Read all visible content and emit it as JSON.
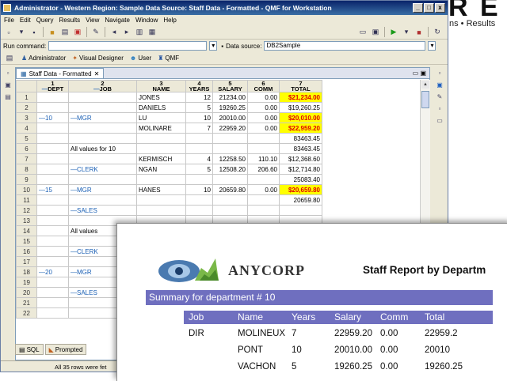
{
  "background_overlay": {
    "big_letters": "R E",
    "text": "ns • Results"
  },
  "window": {
    "title": "Administrator - Western Region: Sample Data Source: Staff Data - Formatted - QMF for Workstation",
    "controls": [
      "_",
      "□",
      "x"
    ]
  },
  "menubar": [
    "File",
    "Edit",
    "Query",
    "Results",
    "View",
    "Navigate",
    "Window",
    "Help"
  ],
  "runbar": {
    "run_label": "Run command:",
    "run_value": "",
    "source_label": "Data source:",
    "source_value": "DB2Sample"
  },
  "perspectives": [
    {
      "icon": "admin-icon",
      "label": "Administrator"
    },
    {
      "icon": "designer-icon",
      "label": "Visual Designer"
    },
    {
      "icon": "user-icon",
      "label": "User"
    },
    {
      "icon": "qmf-icon",
      "label": "QMF"
    }
  ],
  "editor_tab": {
    "label": "Staff Data - Formatted"
  },
  "grid": {
    "col_numbers": [
      "1",
      "2",
      "3",
      "4",
      "5",
      "6",
      "7"
    ],
    "col_headers": [
      "DEPT",
      "JOB",
      "NAME",
      "YEARS",
      "SALARY",
      "COMM",
      "TOTAL"
    ],
    "col_header_prefixes": [
      "—",
      "—",
      "",
      "",
      "",
      "",
      ""
    ],
    "rows": [
      {
        "n": "1",
        "dept": "",
        "job": "",
        "name": "JONES",
        "years": "12",
        "salary": "21234.00",
        "comm": "0.00",
        "total": "$21,234.00",
        "hl": true
      },
      {
        "n": "2",
        "dept": "",
        "job": "",
        "name": "DANIELS",
        "years": "5",
        "salary": "19260.25",
        "comm": "0.00",
        "total": "$19,260.25",
        "hl": false
      },
      {
        "n": "3",
        "dept": "—10",
        "job": "—MGR",
        "name": "LU",
        "years": "10",
        "salary": "20010.00",
        "comm": "0.00",
        "total": "$20,010.00",
        "hl": true
      },
      {
        "n": "4",
        "dept": "",
        "job": "",
        "name": "MOLINARE",
        "years": "7",
        "salary": "22959.20",
        "comm": "0.00",
        "total": "$22,959.20",
        "hl": true
      },
      {
        "n": "5",
        "dept": "",
        "job": "",
        "name": "",
        "years": "",
        "salary": "",
        "comm": "",
        "total": "83463.45",
        "hl": false
      },
      {
        "n": "6",
        "dept": "",
        "job": "All values for 10",
        "name": "",
        "years": "",
        "salary": "",
        "comm": "",
        "total": "83463.45",
        "hl": false
      },
      {
        "n": "7",
        "dept": "",
        "job": "",
        "name": "KERMISCH",
        "years": "4",
        "salary": "12258.50",
        "comm": "110.10",
        "total": "$12,368.60",
        "hl": false
      },
      {
        "n": "8",
        "dept": "",
        "job": "—CLERK",
        "name": "NGAN",
        "years": "5",
        "salary": "12508.20",
        "comm": "206.60",
        "total": "$12,714.80",
        "hl": false
      },
      {
        "n": "9",
        "dept": "",
        "job": "",
        "name": "",
        "years": "",
        "salary": "",
        "comm": "",
        "total": "25083.40",
        "hl": false
      },
      {
        "n": "10",
        "dept": "—15",
        "job": "—MGR",
        "name": "HANES",
        "years": "10",
        "salary": "20659.80",
        "comm": "0.00",
        "total": "$20,659.80",
        "hl": true
      },
      {
        "n": "11",
        "dept": "",
        "job": "",
        "name": "",
        "years": "",
        "salary": "",
        "comm": "",
        "total": "20659.80",
        "hl": false
      },
      {
        "n": "12",
        "dept": "",
        "job": "—SALES",
        "name": "",
        "years": "",
        "salary": "",
        "comm": "",
        "total": "",
        "hl": false
      },
      {
        "n": "13",
        "dept": "",
        "job": "",
        "name": "",
        "years": "",
        "salary": "",
        "comm": "",
        "total": "",
        "hl": false
      },
      {
        "n": "14",
        "dept": "",
        "job": "All values",
        "name": "",
        "years": "",
        "salary": "",
        "comm": "",
        "total": "",
        "hl": false
      },
      {
        "n": "15",
        "dept": "",
        "job": "",
        "name": "",
        "years": "",
        "salary": "",
        "comm": "",
        "total": "",
        "hl": false
      },
      {
        "n": "16",
        "dept": "",
        "job": "—CLERK",
        "name": "",
        "years": "",
        "salary": "",
        "comm": "",
        "total": "",
        "hl": false
      },
      {
        "n": "17",
        "dept": "",
        "job": "",
        "name": "",
        "years": "",
        "salary": "",
        "comm": "",
        "total": "",
        "hl": false
      },
      {
        "n": "18",
        "dept": "—20",
        "job": "—MGR",
        "name": "",
        "years": "",
        "salary": "",
        "comm": "",
        "total": "",
        "hl": false
      },
      {
        "n": "19",
        "dept": "",
        "job": "",
        "name": "",
        "years": "",
        "salary": "",
        "comm": "",
        "total": "",
        "hl": false
      },
      {
        "n": "20",
        "dept": "",
        "job": "—SALES",
        "name": "",
        "years": "",
        "salary": "",
        "comm": "",
        "total": "",
        "hl": false
      },
      {
        "n": "21",
        "dept": "",
        "job": "",
        "name": "",
        "years": "",
        "salary": "",
        "comm": "",
        "total": "",
        "hl": false
      },
      {
        "n": "22",
        "dept": "",
        "job": "",
        "name": "",
        "years": "",
        "salary": "",
        "comm": "",
        "total": "",
        "hl": false
      }
    ]
  },
  "bottom_tabs": [
    "SQL",
    "Prompted"
  ],
  "status": "All 35 rows were fet",
  "report": {
    "logo_text": "ANYCORP",
    "title": "Staff Report by Departm",
    "summary": "Summary for department # 10",
    "headers": [
      "Job",
      "Name",
      "Years",
      "Salary",
      "Comm",
      "Total"
    ],
    "rows": [
      [
        "DIR",
        "MOLINEUX",
        "7",
        "22959.20",
        "0.00",
        "22959.2"
      ],
      [
        "",
        "PONT",
        "10",
        "20010.00",
        "0.00",
        "20010"
      ],
      [
        "",
        "VACHON",
        "5",
        "19260.25",
        "0.00",
        "19260.25"
      ]
    ]
  },
  "colors": {
    "highlight_bg": "#ffff00",
    "highlight_text": "#e00000",
    "report_band": "#6f6fbf"
  }
}
